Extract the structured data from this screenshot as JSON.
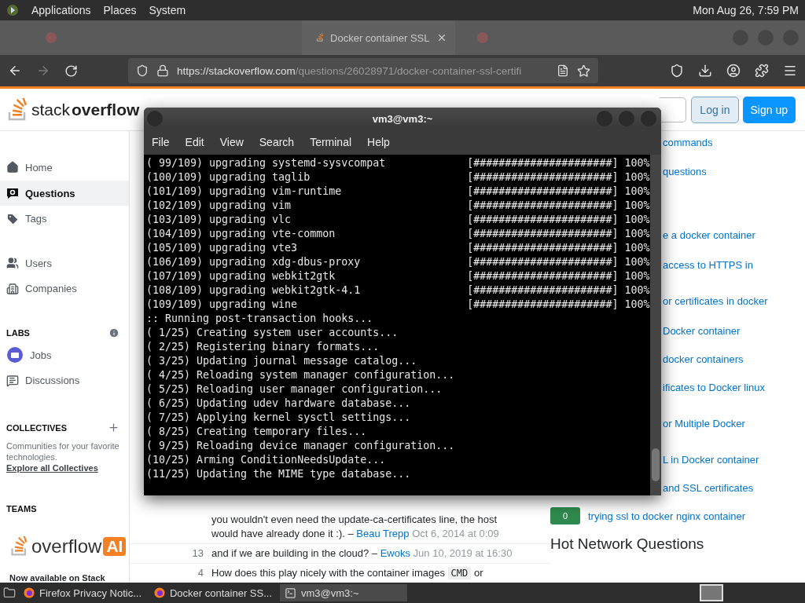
{
  "top_panel": {
    "menus": [
      "Applications",
      "Places",
      "System"
    ],
    "clock": "Mon Aug 26, 7:59 PM"
  },
  "browser": {
    "tabs": [
      {
        "selected": false
      },
      {
        "selected": true,
        "label": "Docker container SSL"
      },
      {
        "selected": false
      }
    ],
    "forward_disabled": true,
    "url_domain": "https://stackoverflow.com",
    "url_path": "/questions/26028971/docker-container-ssl-certifi"
  },
  "site": {
    "logo_light": "stack",
    "logo_bold": "overflow",
    "login": "Log in",
    "signup": "Sign up",
    "sidebar": {
      "groups": [
        [
          {
            "label": "Home",
            "selected": false
          },
          {
            "label": "Questions",
            "selected": true
          },
          {
            "label": "Tags",
            "selected": false
          }
        ],
        [
          {
            "label": "Users",
            "selected": false
          },
          {
            "label": "Companies",
            "selected": false
          }
        ]
      ],
      "labs": {
        "heading": "LABS",
        "items": [
          {
            "label": "Jobs",
            "selected": false
          },
          {
            "label": "Discussions",
            "selected": false
          }
        ]
      },
      "collectives": {
        "heading": "COLLECTIVES",
        "description": "Communities for your favorite technologies.",
        "link": "Explore all Collectives"
      },
      "teams": {
        "heading": "TEAMS",
        "logo_text": "overflow",
        "logo_badge": "AI",
        "promo": "Now available on Stack"
      }
    },
    "comments": [
      {
        "text": "you wouldn't even need the update-ca-certificates line, the host would have already done it :). –",
        "user": "Beau Trepp",
        "date": "Oct 6, 2014 at 0:09"
      },
      {
        "score": "13",
        "text": "and if we are building in the cloud? –",
        "user": "Ewoks",
        "date": "Jun 10, 2019 at 16:30"
      },
      {
        "score": "4",
        "text": "How does this play nicely with the container images",
        "code": "CMD",
        "text_after": "or"
      }
    ],
    "related": [
      "commands",
      "questions",
      "e a docker container",
      "access to HTTPS in",
      "or certificates in docker",
      "Docker container",
      "docker containers",
      "ificates to Docker linux",
      "or Multiple Docker",
      "L in Docker container",
      "and SSL certificates"
    ],
    "related_full": {
      "score": "0",
      "title": "trying ssl to docker nginx container"
    },
    "hot_heading": "Hot Network Questions"
  },
  "terminal": {
    "title": "vm3@vm3:~",
    "menus": [
      "File",
      "Edit",
      "View",
      "Search",
      "Terminal",
      "Help"
    ],
    "lines": [
      {
        "text": "( 99/109) upgrading systemd-sysvcompat",
        "bar": "[######################]",
        "percent": "100%"
      },
      {
        "text": "(100/109) upgrading taglib",
        "bar": "[######################]",
        "percent": "100%"
      },
      {
        "text": "(101/109) upgrading vim-runtime",
        "bar": "[######################]",
        "percent": "100%"
      },
      {
        "text": "(102/109) upgrading vim",
        "bar": "[######################]",
        "percent": "100%"
      },
      {
        "text": "(103/109) upgrading vlc",
        "bar": "[######################]",
        "percent": "100%"
      },
      {
        "text": "(104/109) upgrading vte-common",
        "bar": "[######################]",
        "percent": "100%"
      },
      {
        "text": "(105/109) upgrading vte3",
        "bar": "[######################]",
        "percent": "100%"
      },
      {
        "text": "(106/109) upgrading xdg-dbus-proxy",
        "bar": "[######################]",
        "percent": "100%"
      },
      {
        "text": "(107/109) upgrading webkit2gtk",
        "bar": "[######################]",
        "percent": "100%"
      },
      {
        "text": "(108/109) upgrading webkit2gtk-4.1",
        "bar": "[######################]",
        "percent": "100%"
      },
      {
        "text": "(109/109) upgrading wine",
        "bar": "[######################]",
        "percent": "100%"
      },
      {
        "text": ":: Running post-transaction hooks..."
      },
      {
        "text": "( 1/25) Creating system user accounts..."
      },
      {
        "text": "( 2/25) Registering binary formats..."
      },
      {
        "text": "( 3/25) Updating journal message catalog..."
      },
      {
        "text": "( 4/25) Reloading system manager configuration..."
      },
      {
        "text": "( 5/25) Reloading user manager configuration..."
      },
      {
        "text": "( 6/25) Updating udev hardware database..."
      },
      {
        "text": "( 7/25) Applying kernel sysctl settings..."
      },
      {
        "text": "( 8/25) Creating temporary files..."
      },
      {
        "text": "( 9/25) Reloading device manager configuration..."
      },
      {
        "text": "(10/25) Arming ConditionNeedsUpdate..."
      },
      {
        "text": "(11/25) Updating the MIME type database..."
      }
    ]
  },
  "taskbar": {
    "items": [
      {
        "label": "Firefox Privacy Notic...",
        "kind": "browser",
        "selected": false
      },
      {
        "label": "Docker container SS...",
        "kind": "browser",
        "selected": false
      },
      {
        "label": "vm3@vm3:~",
        "kind": "terminal",
        "selected": true
      }
    ]
  }
}
